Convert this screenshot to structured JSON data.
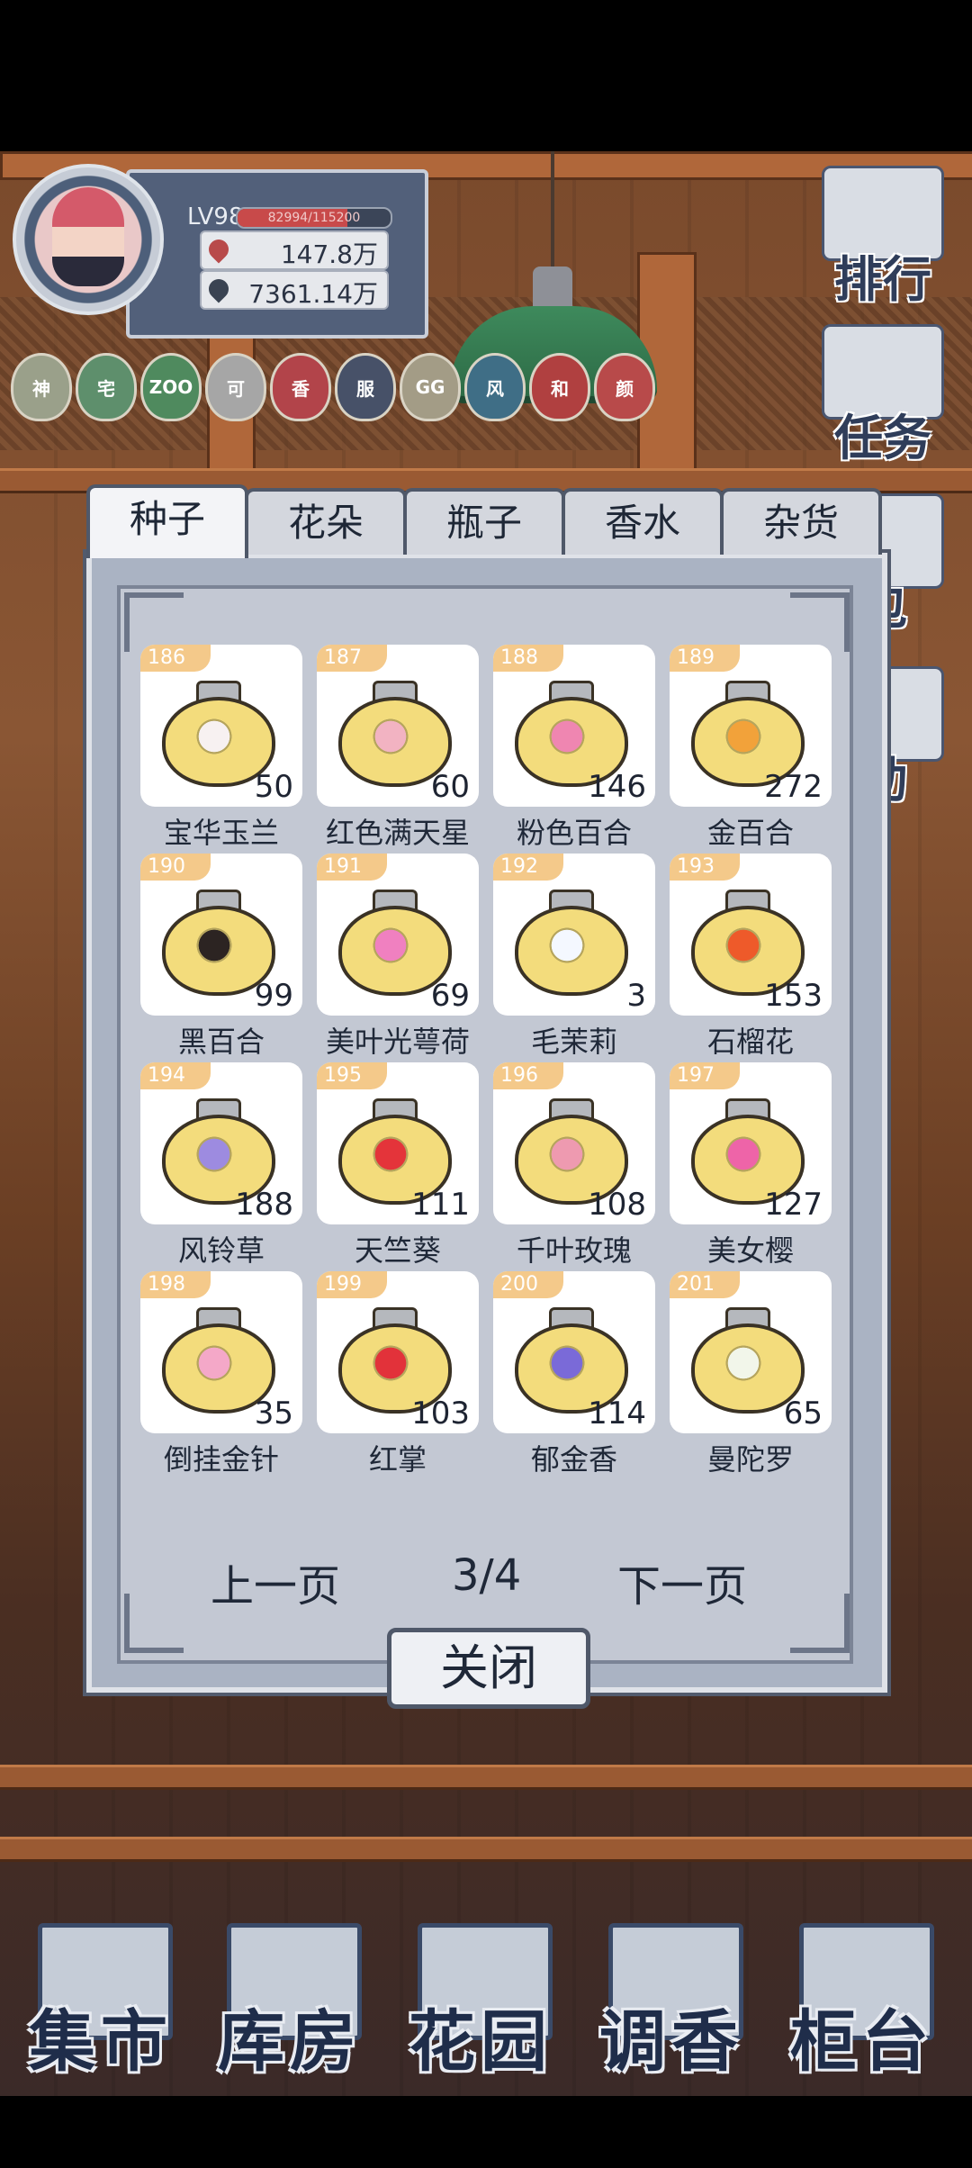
{
  "profile": {
    "level": "LV98",
    "xp_text": "82994/115200",
    "xp_fraction": 0.72,
    "resource1": "147.8万",
    "resource2": "7361.14万"
  },
  "badges": [
    {
      "label": "神",
      "color": "#9aa08a"
    },
    {
      "label": "宅",
      "color": "#5e8f6c"
    },
    {
      "label": "ZOO",
      "color": "#4f8a5e"
    },
    {
      "label": "可",
      "color": "#a6a6a6"
    },
    {
      "label": "香",
      "color": "#b2444a"
    },
    {
      "label": "服",
      "color": "#475168"
    },
    {
      "label": "GG",
      "color": "#a39c86"
    },
    {
      "label": "风",
      "color": "#3f6e86"
    },
    {
      "label": "和",
      "color": "#b04040"
    },
    {
      "label": "颜",
      "color": "#b84a4a"
    }
  ],
  "side_menu": [
    "排行",
    "任务",
    "包",
    "动"
  ],
  "tabs": [
    "种子",
    "花朵",
    "瓶子",
    "香水",
    "杂货"
  ],
  "active_tab": 0,
  "items": [
    {
      "id": "186",
      "count": "50",
      "name": "宝华玉兰",
      "color": "#f7f1f1"
    },
    {
      "id": "187",
      "count": "60",
      "name": "红色满天星",
      "color": "#f2b3c2"
    },
    {
      "id": "188",
      "count": "146",
      "name": "粉色百合",
      "color": "#ef86b1"
    },
    {
      "id": "189",
      "count": "272",
      "name": "金百合",
      "color": "#f2a23a"
    },
    {
      "id": "190",
      "count": "99",
      "name": "黑百合",
      "color": "#2c2422"
    },
    {
      "id": "191",
      "count": "69",
      "name": "美叶光萼荷",
      "color": "#f080c0"
    },
    {
      "id": "192",
      "count": "3",
      "name": "毛茉莉",
      "color": "#f4f8ff"
    },
    {
      "id": "193",
      "count": "153",
      "name": "石榴花",
      "color": "#ee5a2a"
    },
    {
      "id": "194",
      "count": "188",
      "name": "风铃草",
      "color": "#9d8be0"
    },
    {
      "id": "195",
      "count": "111",
      "name": "天竺葵",
      "color": "#e4343a"
    },
    {
      "id": "196",
      "count": "108",
      "name": "千叶玫瑰",
      "color": "#ee9ab0"
    },
    {
      "id": "197",
      "count": "127",
      "name": "美女樱",
      "color": "#ee64a8"
    },
    {
      "id": "198",
      "count": "35",
      "name": "倒挂金针",
      "color": "#f4a8c8"
    },
    {
      "id": "199",
      "count": "103",
      "name": "红掌",
      "color": "#e2323a"
    },
    {
      "id": "200",
      "count": "114",
      "name": "郁金香",
      "color": "#7a6ad8"
    },
    {
      "id": "201",
      "count": "65",
      "name": "曼陀罗",
      "color": "#f2f6ea"
    }
  ],
  "pager": {
    "prev": "上一页",
    "page": "3/4",
    "next": "下一页"
  },
  "close_label": "关闭",
  "bottom_nav": [
    "集市",
    "库房",
    "花园",
    "调香",
    "柜台"
  ]
}
